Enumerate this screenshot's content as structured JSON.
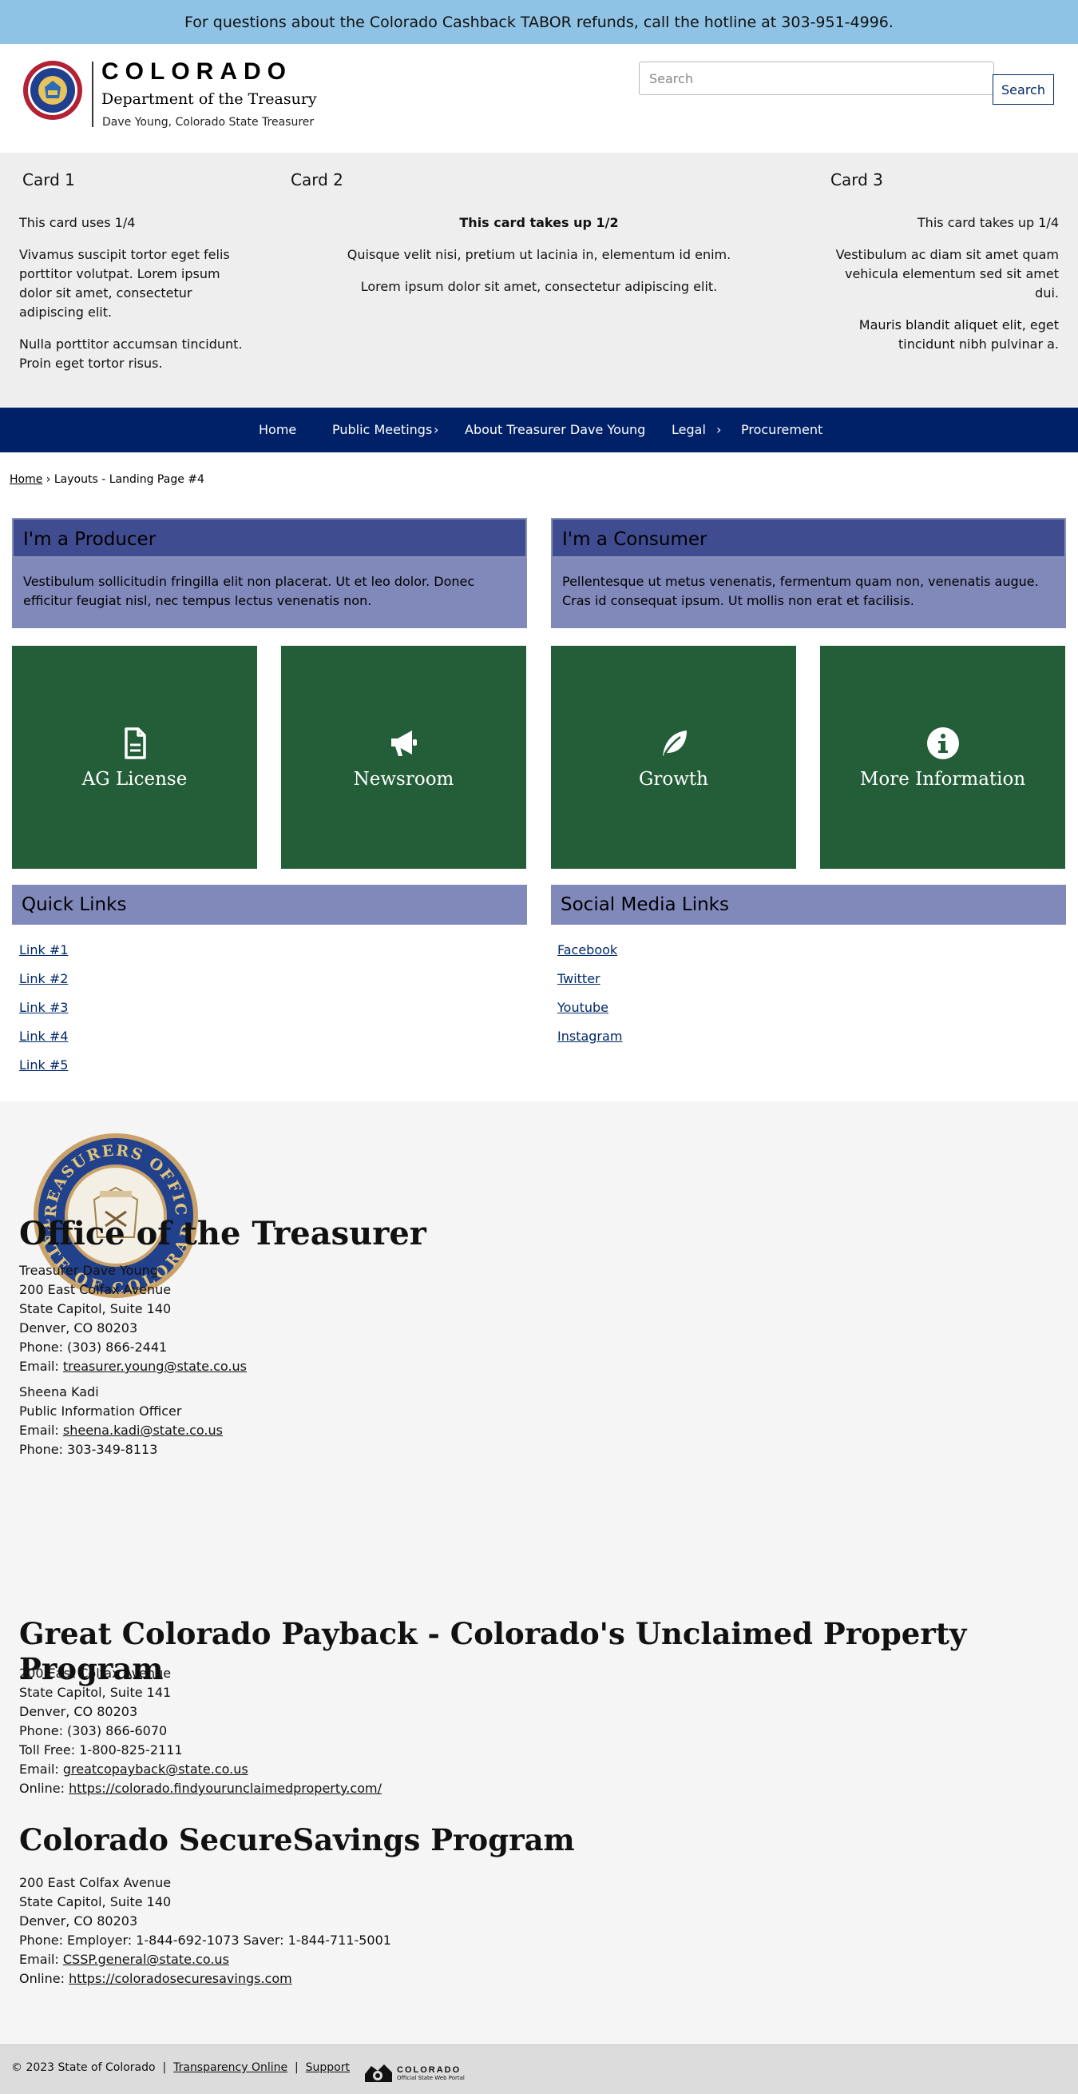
{
  "alert": {
    "text": "For questions about the Colorado Cashback TABOR refunds, call the hotline at 303-951-4996."
  },
  "header": {
    "logo_title": "COLORADO",
    "logo_dept": "Department of the Treasury",
    "logo_sub": "Dave Young, Colorado State Treasurer",
    "search_placeholder": "Search",
    "search_button": "Search"
  },
  "cards": [
    {
      "title": "Card 1",
      "lead": "This card uses 1/4",
      "paras": [
        "Vivamus suscipit tortor eget felis porttitor volutpat. Lorem ipsum dolor sit amet, consectetur adipiscing elit.",
        "Nulla porttitor accumsan tincidunt. Proin eget tortor risus."
      ]
    },
    {
      "title": "Card 2",
      "lead": "This card takes up 1/2",
      "paras": [
        "Quisque velit nisi, pretium ut lacinia in, elementum id enim.",
        "Lorem ipsum dolor sit amet, consectetur adipiscing elit."
      ]
    },
    {
      "title": "Card 3",
      "lead": "This card takes up 1/4",
      "paras": [
        "Vestibulum ac diam sit amet quam vehicula elementum sed sit amet dui.",
        "Mauris blandit aliquet elit, eget tincidunt nibh pulvinar a."
      ]
    }
  ],
  "nav": {
    "items": [
      "Home",
      "Public Meetings",
      "About Treasurer Dave Young",
      "Legal",
      "Procurement"
    ],
    "chevron": "›"
  },
  "breadcrumb": {
    "home": "Home",
    "sep": "›",
    "current": "Layouts - Landing Page #4"
  },
  "boxes": [
    {
      "title": "I'm a Producer",
      "body": "Vestibulum sollicitudin fringilla elit non placerat. Ut et leo dolor. Donec efficitur feugiat nisl, nec tempus lectus venenatis non."
    },
    {
      "title": "I'm a Consumer",
      "body": "Pellentesque ut metus venenatis, fermentum quam non, venenatis augue. Cras id consequat ipsum. Ut mollis non erat et facilisis."
    }
  ],
  "tiles": [
    {
      "label": "AG License",
      "icon": "file-icon"
    },
    {
      "label": "Newsroom",
      "icon": "megaphone-icon"
    },
    {
      "label": "Growth",
      "icon": "leaf-icon"
    },
    {
      "label": "More Information",
      "icon": "info-icon"
    }
  ],
  "quick_links": {
    "title": "Quick Links",
    "items": [
      "Link #1",
      "Link #2",
      "Link #3",
      "Link #4",
      "Link #5"
    ]
  },
  "social_links": {
    "title": "Social Media Links",
    "items": [
      "Facebook",
      "Twitter",
      "Youtube",
      "Instagram"
    ]
  },
  "footer": {
    "seal_text_top": "TREASURERS OFFICE",
    "seal_text_bottom": "STATE OF COLORADO",
    "office": {
      "title": "Office of the Treasurer",
      "lines": [
        "Treasurer Dave Young",
        "200 East Colfax Avenue",
        "State Capitol, Suite 140",
        "Denver, CO 80203",
        "Phone: (303) 866-2441"
      ],
      "email_label": "Email: ",
      "email": "treasurer.young@state.co.us",
      "contact_lines": [
        "Sheena Kadi",
        "Public Information Officer"
      ],
      "contact_email_label": "Email: ",
      "contact_email": "sheena.kadi@state.co.us",
      "contact_phone": "Phone: 303-349-8113"
    },
    "payback": {
      "title": "Great Colorado Payback - Colorado's Unclaimed Property Program",
      "lines": [
        "200 East Colfax Avenue",
        "State Capitol, Suite 141",
        "Denver, CO 80203",
        "Phone: (303) 866-6070",
        "Toll Free:  1-800-825-2111"
      ],
      "email_label": "Email: ",
      "email": "greatcopayback@state.co.us",
      "online_label": "Online: ",
      "online": "https://colorado.findyourunclaimedproperty.com/"
    },
    "securesavings": {
      "title": "Colorado SecureSavings Program",
      "lines": [
        "200 East Colfax Avenue",
        "State Capitol, Suite 140",
        "Denver, CO 80203",
        "Phone: Employer: 1-844-692-1073  Saver: 1-844-711-5001"
      ],
      "email_label": "Email: ",
      "email": "CSSP.general@state.co.us",
      "online_label": "Online: ",
      "online": "https://coloradosecuresavings.com"
    },
    "bottom": {
      "copyright": "© 2023 State of Colorado",
      "sep": "|",
      "links": [
        "Transparency Online",
        "Support"
      ],
      "logo_title": "COLORADO",
      "logo_sub": "Official State Web Portal"
    }
  },
  "colors": {
    "alert": "#8fc3e5",
    "nav": "#002068",
    "box_head": "#404c90",
    "box_body": "#8189bb",
    "tile": "#235e39",
    "footer": "#f5f5f5"
  }
}
